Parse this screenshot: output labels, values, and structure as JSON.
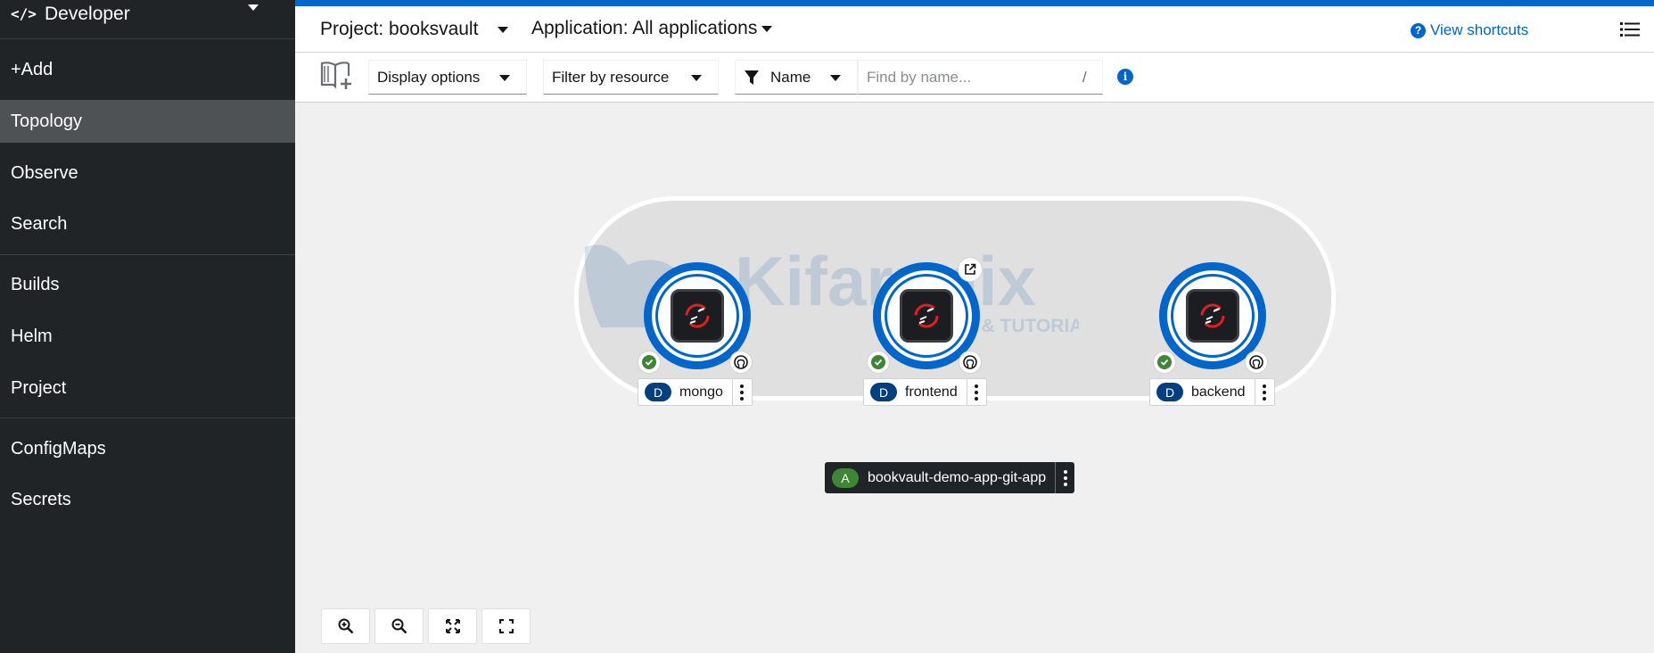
{
  "sidebar": {
    "perspective": "Developer",
    "items": [
      {
        "label": "+Add"
      },
      {
        "label": "Topology",
        "active": true
      },
      {
        "label": "Observe"
      },
      {
        "label": "Search"
      },
      {
        "label": "Builds"
      },
      {
        "label": "Helm"
      },
      {
        "label": "Project"
      },
      {
        "label": "ConfigMaps"
      },
      {
        "label": "Secrets"
      }
    ]
  },
  "header": {
    "project": "Project: booksvault",
    "application": "Application: All applications",
    "shortcuts": "View shortcuts"
  },
  "toolbar": {
    "display_options": "Display options",
    "filter_by_resource": "Filter by resource",
    "filter_type": "Name",
    "search_placeholder": "Find by name...",
    "search_hint": "/"
  },
  "topology": {
    "watermark": "Kifarunix",
    "watermark_sub": "*NIX TIPS & TUTORIALS",
    "nodes": [
      {
        "kind": "D",
        "name": "mongo",
        "status": "running",
        "source": "github-icon"
      },
      {
        "kind": "D",
        "name": "frontend",
        "status": "running",
        "source": "github-icon",
        "route": "open-url-icon"
      },
      {
        "kind": "D",
        "name": "backend",
        "status": "running",
        "source": "github-icon"
      }
    ],
    "application": {
      "kind": "A",
      "name": "bookvault-demo-app-git-app"
    }
  },
  "colors": {
    "accent": "#0066cc",
    "sidebar": "#212427",
    "active_nav": "#4f5255",
    "deployment_badge": "#004080",
    "application_badge": "#3e8635",
    "status_ok": "#3e8635"
  },
  "zoom_controls": [
    "zoom-in-icon",
    "zoom-out-icon",
    "fit-to-screen-icon",
    "reset-view-icon"
  ]
}
